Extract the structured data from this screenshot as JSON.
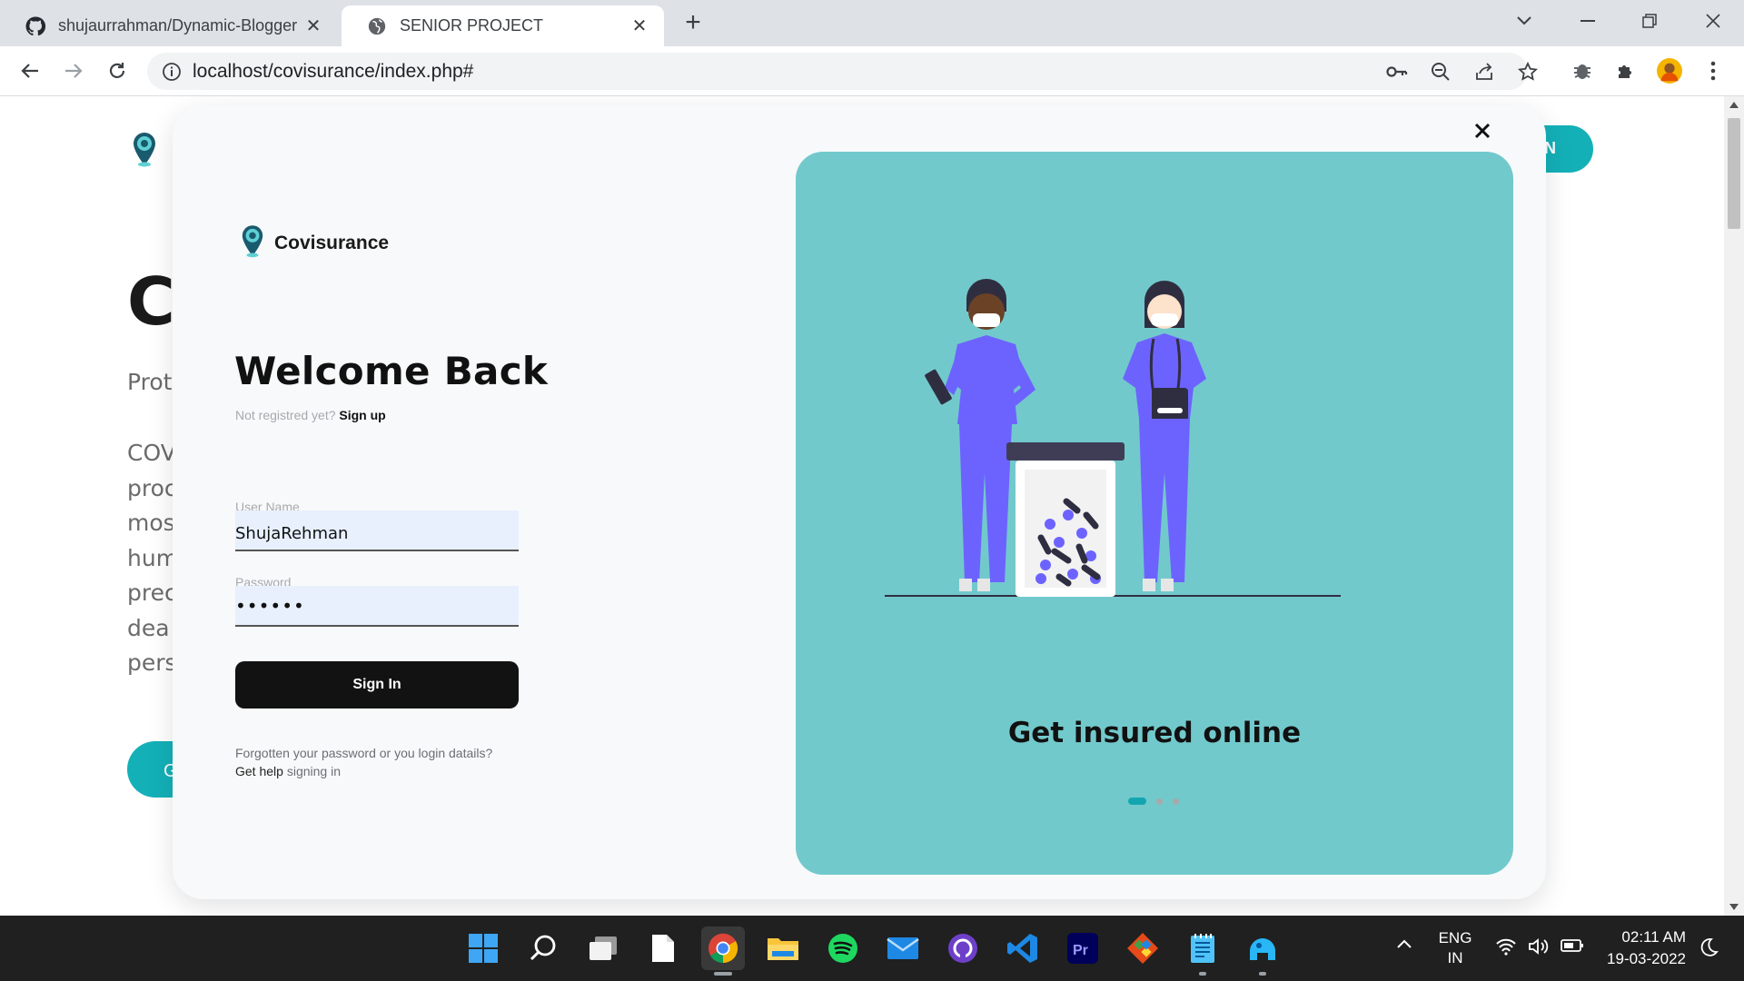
{
  "browser": {
    "tabs": [
      {
        "title": "shujaurrahman/Dynamic-Blogger",
        "active": false,
        "favicon": "github-icon"
      },
      {
        "title": "SENIOR PROJECT",
        "active": true,
        "favicon": "globe-icon"
      }
    ],
    "url": "localhost/covisurance/index.php#"
  },
  "background_page": {
    "heading_fragment": "C",
    "subheading_fragment": "Prot",
    "paragraph_fragments": [
      "COV",
      "proc",
      "mos",
      "hum",
      "prec",
      "dea",
      "pers"
    ],
    "button_fragment": "G",
    "signin_fragment": "N"
  },
  "modal": {
    "brand": "Covisurance",
    "title": "Welcome Back",
    "signup_prompt": "Not registred yet?",
    "signup_link": "Sign up",
    "username_label": "User Name",
    "username_value": "ShujaRehman",
    "password_label": "Password",
    "password_value": "••••••",
    "signin_button": "Sign In",
    "forgot_text": "Forgotten your password or you login datails?",
    "help_link": "Get help",
    "help_suffix": "signing in",
    "panel_caption": "Get insured online",
    "carousel": {
      "count": 3,
      "active_index": 0
    }
  },
  "taskbar": {
    "apps": [
      "windows-start-icon",
      "search-icon",
      "task-view-icon",
      "notepad-file-icon",
      "chrome-icon",
      "file-explorer-icon",
      "spotify-icon",
      "mail-icon",
      "github-desktop-icon",
      "vscode-icon",
      "premiere-pro-icon",
      "git-icon",
      "notepad-icon",
      "blue-app-icon"
    ],
    "language": "ENG",
    "region": "IN",
    "time": "02:11 AM",
    "date": "19-03-2022"
  },
  "colors": {
    "accent": "#14b0b8",
    "panel_bg": "#72c9cc",
    "scrub_purple": "#6c63ff",
    "button_dark": "#121212"
  }
}
